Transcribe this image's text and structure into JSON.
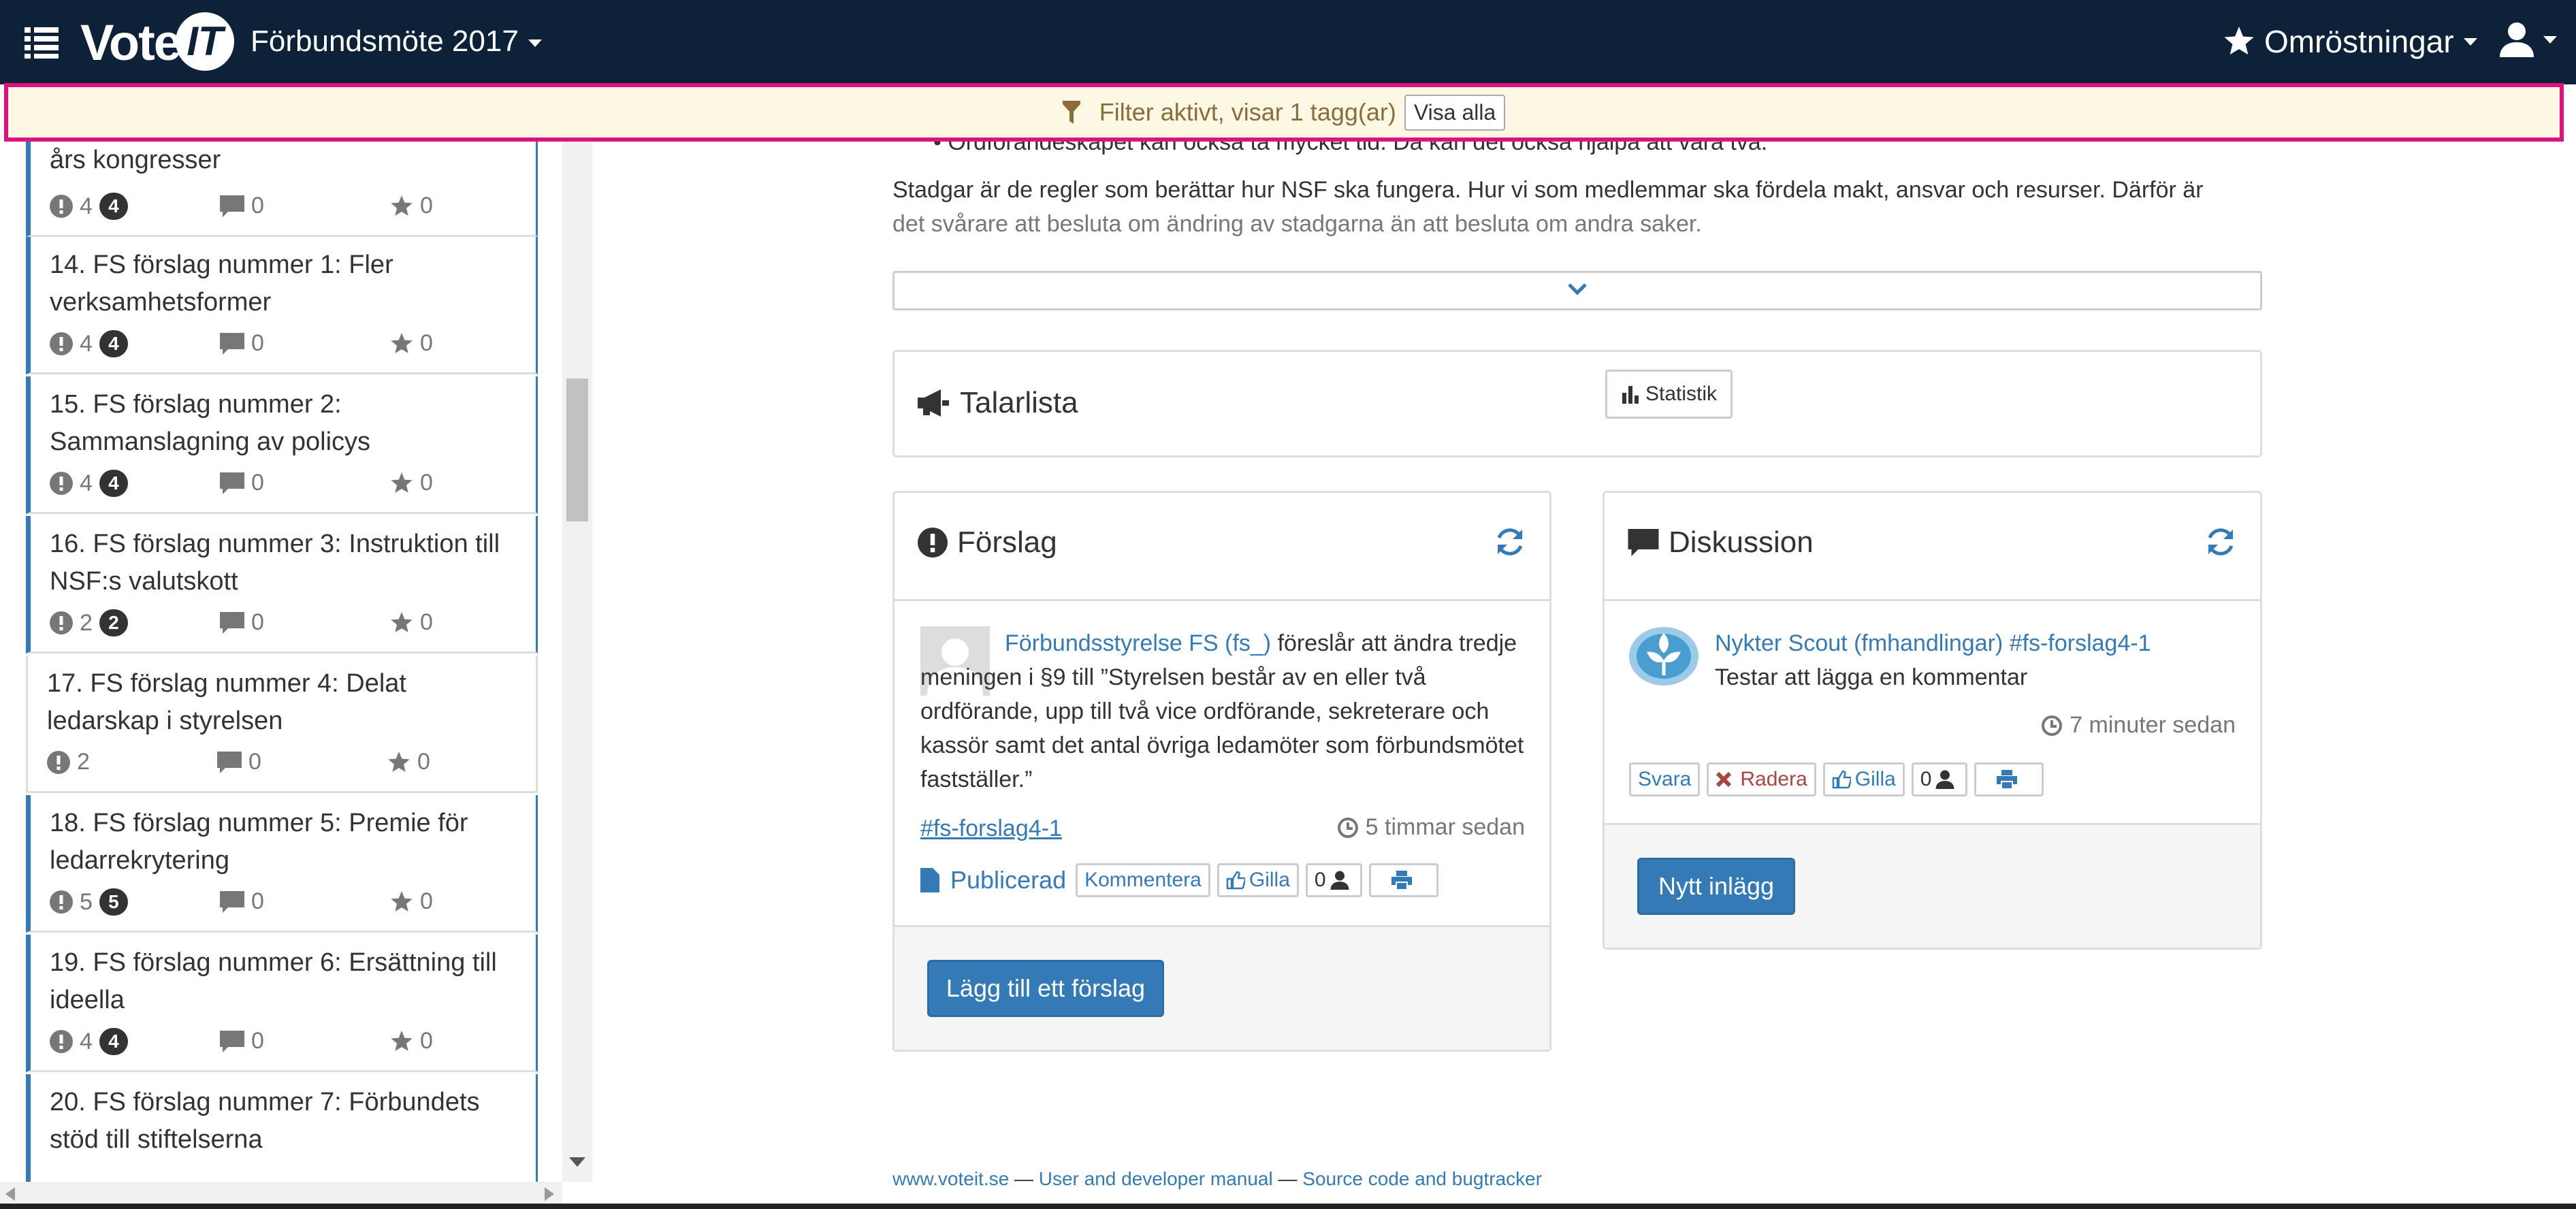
{
  "navbar": {
    "logo_vote": "Vote",
    "logo_it": "IT",
    "meeting_title": "Förbundsmöte 2017",
    "polls_label": "Omröstningar"
  },
  "filter": {
    "text": "Filter aktivt, visar 1 tagg(ar)",
    "show_all": "Visa alla"
  },
  "sidebar": {
    "partial_item": {
      "title": "års kongresser",
      "proposals": "4",
      "badge": "4",
      "comments": "0",
      "stars": "0"
    },
    "items": [
      {
        "title": "14. FS förslag nummer 1: Fler verksamhetsformer",
        "proposals": "4",
        "badge": "4",
        "comments": "0",
        "stars": "0"
      },
      {
        "title": "15. FS förslag nummer 2: Sammanslagning av policys",
        "proposals": "4",
        "badge": "4",
        "comments": "0",
        "stars": "0"
      },
      {
        "title": "16. FS förslag nummer 3: Instruktion till NSF:s valutskott",
        "proposals": "2",
        "badge": "2",
        "comments": "0",
        "stars": "0"
      },
      {
        "title": "17. FS förslag nummer 4: Delat ledarskap i styrelsen",
        "proposals": "2",
        "badge": "",
        "comments": "0",
        "stars": "0"
      },
      {
        "title": "18. FS förslag nummer 5: Premie för ledarrekrytering",
        "proposals": "5",
        "badge": "5",
        "comments": "0",
        "stars": "0"
      },
      {
        "title": "19. FS förslag nummer 6: Ersättning till ideella",
        "proposals": "4",
        "badge": "4",
        "comments": "0",
        "stars": "0"
      },
      {
        "title": "20. FS förslag nummer 7: Förbundets stöd till stiftelserna",
        "proposals": "",
        "badge": "",
        "comments": "",
        "stars": ""
      }
    ]
  },
  "main": {
    "intro_partial": "Ordförandeskapet kan också ta mycket tid. Då kan det också hjälpa att vara två.",
    "intro_p1": "Stadgar är de regler som berättar hur NSF ska fungera. Hur vi som medlemmar ska fördela makt, ansvar och resurser. Därför är",
    "intro_p2": "det svårare att besluta om ändring av stadgarna än att besluta om andra saker.",
    "speakers": {
      "title": "Talarlista",
      "stats_button": "Statistik"
    },
    "proposals": {
      "title": "Förslag",
      "author": "Förbundsstyrelse FS (fs_)",
      "text": " föreslår att ändra tredje meningen i §9 till ”Styrelsen består av en eller två ordförande, upp till två vice ordförande, sekreterare och kassör samt det antal övriga ledamöter som förbundsmötet fastställer.”",
      "tag": "#fs-forslag4-1",
      "time": "5 timmar sedan",
      "status": "Publicerad",
      "comment_button": "Kommentera",
      "like_button": "Gilla",
      "like_count": "0",
      "add_button": "Lägg till ett förslag"
    },
    "discussion": {
      "title": "Diskussion",
      "author": "Nykter Scout (fmhandlingar) #fs-forslag4-1",
      "text": "Testar att lägga en kommentar",
      "time": "7 minuter sedan",
      "reply_button": "Svara",
      "delete_button": "Radera",
      "like_button": "Gilla",
      "like_count": "0",
      "new_post_button": "Nytt inlägg"
    }
  },
  "footer": {
    "site": "www.voteit.se",
    "sep1": " — ",
    "manual": "User and developer manual",
    "sep2": " — ",
    "source": "Source code and bugtracker"
  },
  "colors": {
    "navbar": "#0d2138",
    "link": "#337ab7",
    "filter_bg": "#fcf8e3",
    "highlight_border": "#e0107e",
    "danger": "#a94442"
  }
}
